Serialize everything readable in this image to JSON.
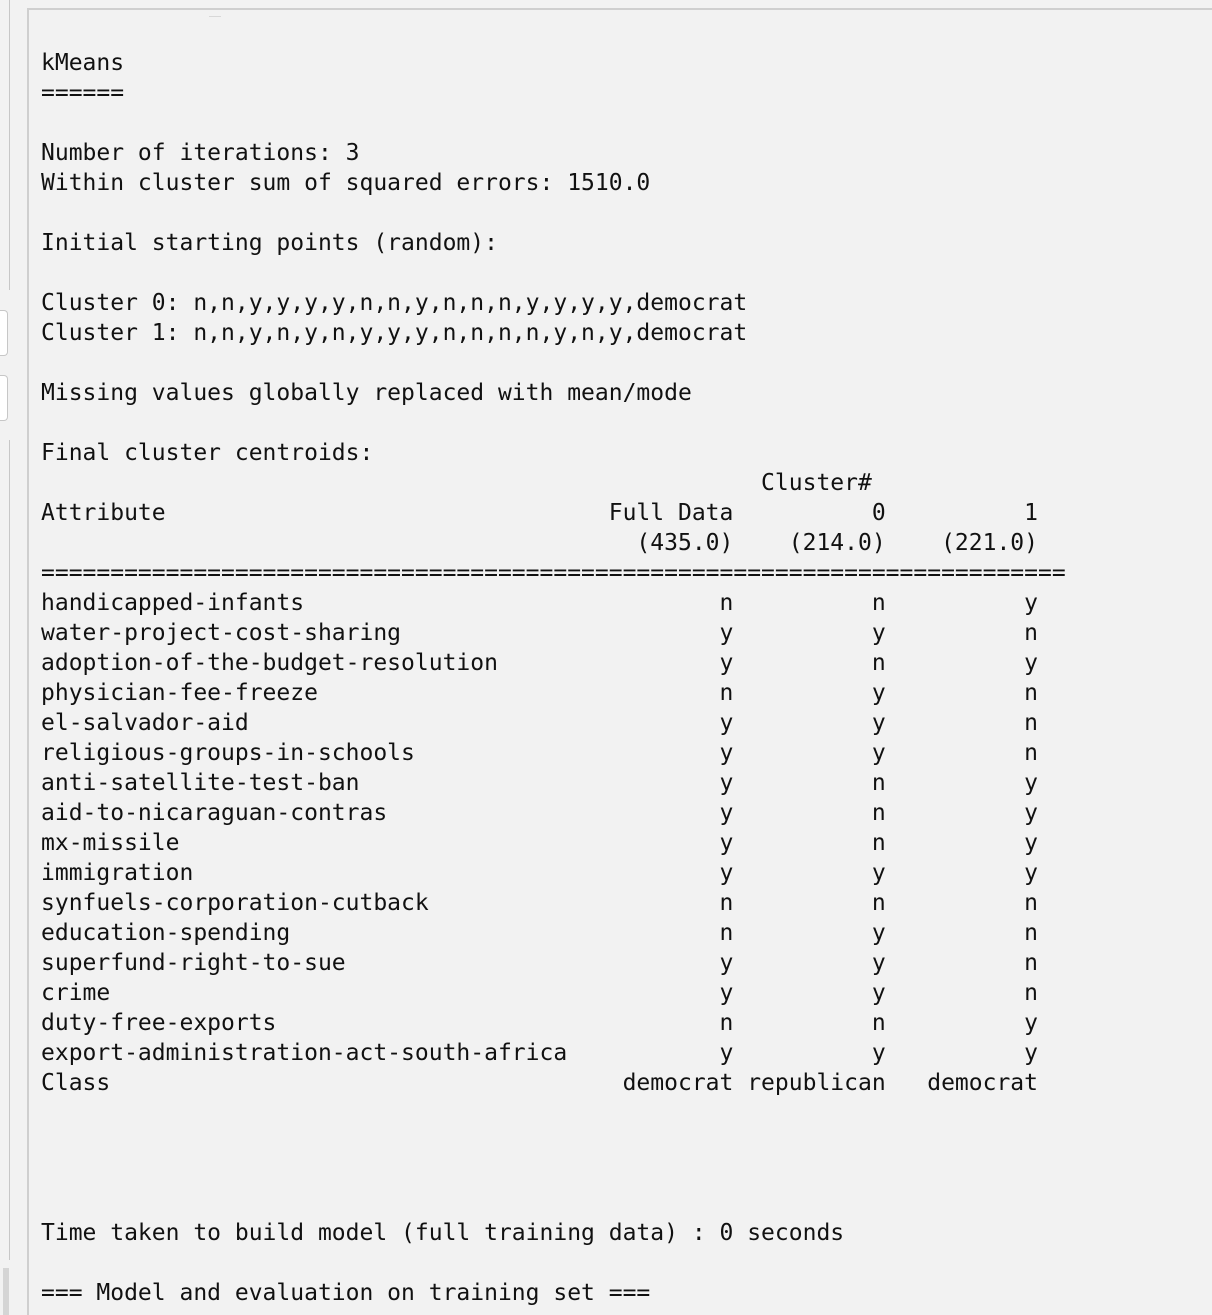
{
  "output": {
    "lines": [
      "kMeans",
      "======",
      "",
      "Number of iterations: 3",
      "Within cluster sum of squared errors: 1510.0",
      "",
      "Initial starting points (random):",
      "",
      "Cluster 0: n,n,y,y,y,y,n,n,y,n,n,n,y,y,y,y,democrat",
      "Cluster 1: n,n,y,n,y,n,y,y,y,n,n,n,n,y,n,y,democrat",
      "",
      "Missing values globally replaced with mean/mode",
      "",
      "Final cluster centroids:",
      "                                                    Cluster#",
      "Attribute                                Full Data          0          1",
      "                                           (435.0)    (214.0)    (221.0)",
      "==========================================================================",
      "handicapped-infants                              n          n          y",
      "water-project-cost-sharing                       y          y          n",
      "adoption-of-the-budget-resolution                y          n          y",
      "physician-fee-freeze                             n          y          n",
      "el-salvador-aid                                  y          y          n",
      "religious-groups-in-schools                      y          y          n",
      "anti-satellite-test-ban                          y          n          y",
      "aid-to-nicaraguan-contras                        y          n          y",
      "mx-missile                                       y          n          y",
      "immigration                                      y          y          y",
      "synfuels-corporation-cutback                     n          n          n",
      "education-spending                               n          y          n",
      "superfund-right-to-sue                           y          y          n",
      "crime                                            y          y          n",
      "duty-free-exports                                n          n          y",
      "export-administration-act-south-africa           y          y          y",
      "Class                                     democrat republican   democrat",
      "",
      "",
      "",
      "",
      "Time taken to build model (full training data) : 0 seconds",
      "",
      "=== Model and evaluation on training set ==="
    ]
  }
}
